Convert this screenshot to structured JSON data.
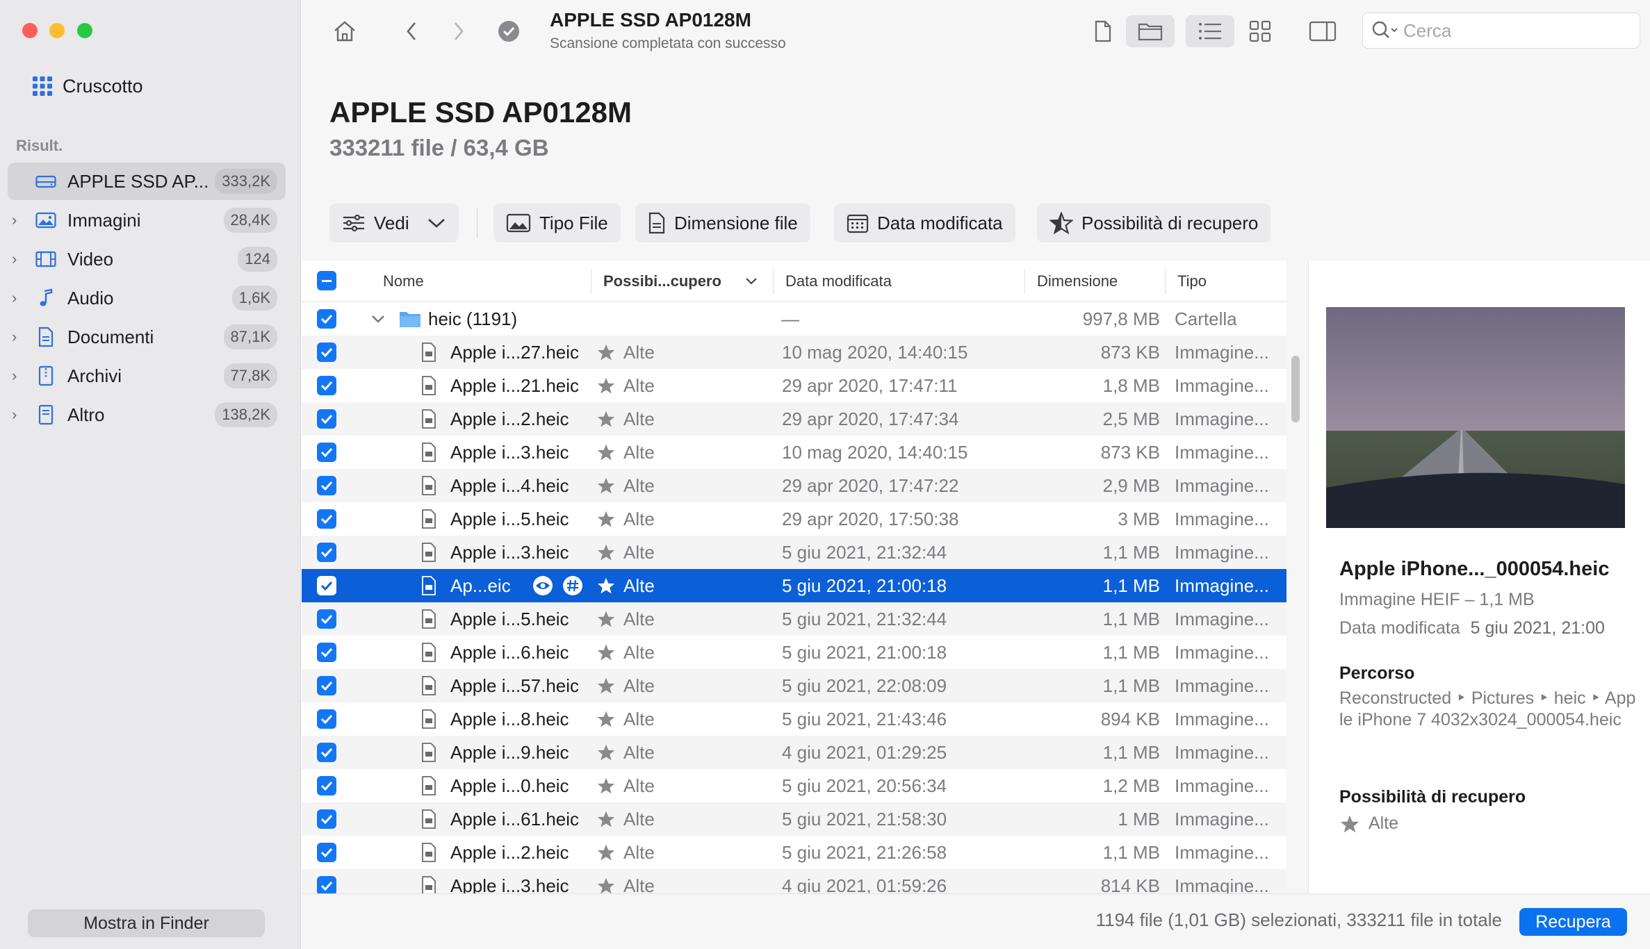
{
  "sidebar": {
    "dashboard_label": "Cruscotto",
    "section_label": "Risult.",
    "items": [
      {
        "label": "APPLE SSD AP...",
        "count": "333,2K",
        "icon": "drive-icon"
      },
      {
        "label": "Immagini",
        "count": "28,4K",
        "icon": "image-icon"
      },
      {
        "label": "Video",
        "count": "124",
        "icon": "video-icon"
      },
      {
        "label": "Audio",
        "count": "1,6K",
        "icon": "music-icon"
      },
      {
        "label": "Documenti",
        "count": "87,1K",
        "icon": "document-icon"
      },
      {
        "label": "Archivi",
        "count": "77,8K",
        "icon": "archive-icon"
      },
      {
        "label": "Altro",
        "count": "138,2K",
        "icon": "other-icon"
      }
    ],
    "finder_button": "Mostra in Finder"
  },
  "toolbar": {
    "title": "APPLE SSD AP0128M",
    "subtitle": "Scansione completata con successo",
    "search_placeholder": "Cerca"
  },
  "header": {
    "title": "APPLE SSD AP0128M",
    "subtitle": "333211 file / 63,4 GB"
  },
  "filters": {
    "view": "Vedi",
    "file_type": "Tipo File",
    "file_size": "Dimensione file",
    "date_modified": "Data modificata",
    "recovery_chance": "Possibilità di recupero"
  },
  "table": {
    "columns": {
      "name": "Nome",
      "recovery": "Possibi...cupero",
      "date": "Data modificata",
      "size": "Dimensione",
      "type": "Tipo"
    },
    "folder": {
      "name": "heic (1191)",
      "date": "—",
      "size": "997,8 MB",
      "type": "Cartella"
    },
    "rows": [
      {
        "name": "Apple i...27.heic",
        "chance": "Alte",
        "date": "10 mag 2020, 14:40:15",
        "size": "873 KB",
        "type": "Immagine..."
      },
      {
        "name": "Apple i...21.heic",
        "chance": "Alte",
        "date": "29 apr 2020, 17:47:11",
        "size": "1,8 MB",
        "type": "Immagine..."
      },
      {
        "name": "Apple i...2.heic",
        "chance": "Alte",
        "date": "29 apr 2020, 17:47:34",
        "size": "2,5 MB",
        "type": "Immagine..."
      },
      {
        "name": "Apple i...3.heic",
        "chance": "Alte",
        "date": "10 mag 2020, 14:40:15",
        "size": "873 KB",
        "type": "Immagine..."
      },
      {
        "name": "Apple i...4.heic",
        "chance": "Alte",
        "date": "29 apr 2020, 17:47:22",
        "size": "2,9 MB",
        "type": "Immagine..."
      },
      {
        "name": "Apple i...5.heic",
        "chance": "Alte",
        "date": "29 apr 2020, 17:50:38",
        "size": "3 MB",
        "type": "Immagine..."
      },
      {
        "name": "Apple i...3.heic",
        "chance": "Alte",
        "date": "5 giu 2021, 21:32:44",
        "size": "1,1 MB",
        "type": "Immagine..."
      },
      {
        "name": "Ap...eic",
        "chance": "Alte",
        "date": "5 giu 2021, 21:00:18",
        "size": "1,1 MB",
        "type": "Immagine...",
        "selected": true
      },
      {
        "name": "Apple i...5.heic",
        "chance": "Alte",
        "date": "5 giu 2021, 21:32:44",
        "size": "1,1 MB",
        "type": "Immagine..."
      },
      {
        "name": "Apple i...6.heic",
        "chance": "Alte",
        "date": "5 giu 2021, 21:00:18",
        "size": "1,1 MB",
        "type": "Immagine..."
      },
      {
        "name": "Apple i...57.heic",
        "chance": "Alte",
        "date": "5 giu 2021, 22:08:09",
        "size": "1,1 MB",
        "type": "Immagine..."
      },
      {
        "name": "Apple i...8.heic",
        "chance": "Alte",
        "date": "5 giu 2021, 21:43:46",
        "size": "894 KB",
        "type": "Immagine..."
      },
      {
        "name": "Apple i...9.heic",
        "chance": "Alte",
        "date": "4 giu 2021, 01:29:25",
        "size": "1,1 MB",
        "type": "Immagine..."
      },
      {
        "name": "Apple i...0.heic",
        "chance": "Alte",
        "date": "5 giu 2021, 20:56:34",
        "size": "1,2 MB",
        "type": "Immagine..."
      },
      {
        "name": "Apple i...61.heic",
        "chance": "Alte",
        "date": "5 giu 2021, 21:58:30",
        "size": "1 MB",
        "type": "Immagine..."
      },
      {
        "name": "Apple i...2.heic",
        "chance": "Alte",
        "date": "5 giu 2021, 21:26:58",
        "size": "1,1 MB",
        "type": "Immagine..."
      },
      {
        "name": "Apple i...3.heic",
        "chance": "Alte",
        "date": "4 giu 2021, 01:59:26",
        "size": "814 KB",
        "type": "Immagine..."
      }
    ]
  },
  "preview": {
    "name": "Apple iPhone..._000054.heic",
    "kind": "Immagine HEIF – 1,1 MB",
    "date_label": "Data modificata",
    "date_value": "5 giu 2021, 21:00",
    "path_heading": "Percorso",
    "path": "Reconstructed ‣ Pictures ‣ heic ‣ Apple iPhone 7 4032x3024_000054.heic",
    "chance_heading": "Possibilità di recupero",
    "chance_value": "Alte"
  },
  "footer": {
    "status": "1194 file (1,01 GB) selezionati, 333211 file in totale",
    "recover_button": "Recupera"
  },
  "colors": {
    "accent": "#0b5fd8",
    "checkbox": "#1377f5",
    "sidebar_bg": "#e9e8ea"
  }
}
